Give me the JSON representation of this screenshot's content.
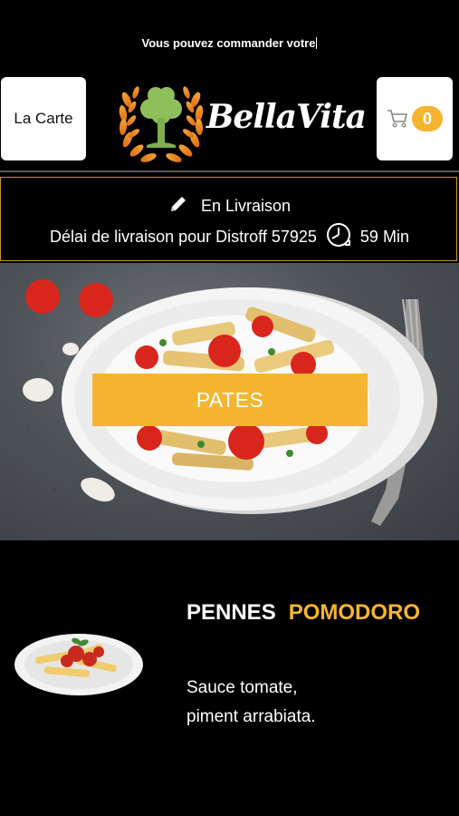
{
  "header": {
    "marquee_text": "Vous pouvez commander votre",
    "menu_button_label": "La Carte",
    "brand_name": "BellaVita",
    "cart_count": "0"
  },
  "delivery": {
    "mode_label": "En Livraison",
    "delay_text": "Délai de livraison pour Distroff 57925",
    "delay_value": "59 Min"
  },
  "hero": {
    "category_label": "PATES"
  },
  "product": {
    "name_part1": "PENNES",
    "name_part2": "POMODORO",
    "description_line1": "Sauce tomate,",
    "description_line2": "piment arrabiata."
  },
  "colors": {
    "accent": "#f6b530",
    "background": "#000000",
    "border": "#c9922a"
  }
}
